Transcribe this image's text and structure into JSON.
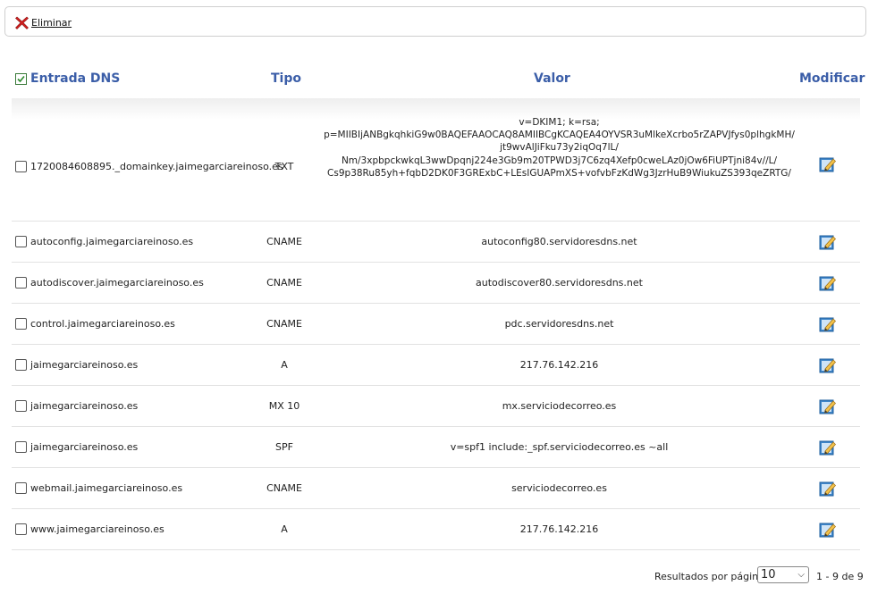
{
  "toolbar": {
    "delete_label": "Eliminar"
  },
  "table": {
    "headers": {
      "entrada": "Entrada DNS",
      "tipo": "Tipo",
      "valor": "Valor",
      "modificar": "Modificar"
    },
    "rows": [
      {
        "name": "1720084608895._domainkey.jaimegarciareinoso.es",
        "type": "TXT",
        "value": "v=DKIM1; k=rsa;\np=MIIBIjANBgkqhkiG9w0BAQEFAAOCAQ8AMIIBCgKCAQEA4OYVSR3uMlkeXcrbo5rZAPVJfys0plhgkMH/\njt9wvAlJiFku73y2iqOq7lL/\nNm/3xpbpckwkqL3wwDpqnj224e3Gb9m20TPWD3j7C6zq4Xefp0cweLAz0jOw6FiUPTjni84v//L/\nCs9p38Ru85yh+fqbD2DK0F3GRExbC+LEsIGUAPmXS+vofvbFzKdWg3JzrHuB9WiukuZS393qeZRTG/"
      },
      {
        "name": "autoconfig.jaimegarciareinoso.es",
        "type": "CNAME",
        "value": "autoconfig80.servidoresdns.net"
      },
      {
        "name": "autodiscover.jaimegarciareinoso.es",
        "type": "CNAME",
        "value": "autodiscover80.servidoresdns.net"
      },
      {
        "name": "control.jaimegarciareinoso.es",
        "type": "CNAME",
        "value": "pdc.servidoresdns.net"
      },
      {
        "name": "jaimegarciareinoso.es",
        "type": "A",
        "value": "217.76.142.216"
      },
      {
        "name": "jaimegarciareinoso.es",
        "type": "MX 10",
        "value": "mx.serviciodecorreo.es"
      },
      {
        "name": "jaimegarciareinoso.es",
        "type": "SPF",
        "value": "v=spf1 include:_spf.serviciodecorreo.es ~all"
      },
      {
        "name": "webmail.jaimegarciareinoso.es",
        "type": "CNAME",
        "value": "serviciodecorreo.es"
      },
      {
        "name": "www.jaimegarciareinoso.es",
        "type": "A",
        "value": "217.76.142.216"
      }
    ]
  },
  "footer": {
    "results_label": "Resultados por página",
    "per_page": "10",
    "range": "1 - 9 de 9"
  },
  "icons": {
    "delete": "red-x-icon",
    "edit": "edit-pencil-icon",
    "select_all": "checked-checkbox-icon"
  }
}
